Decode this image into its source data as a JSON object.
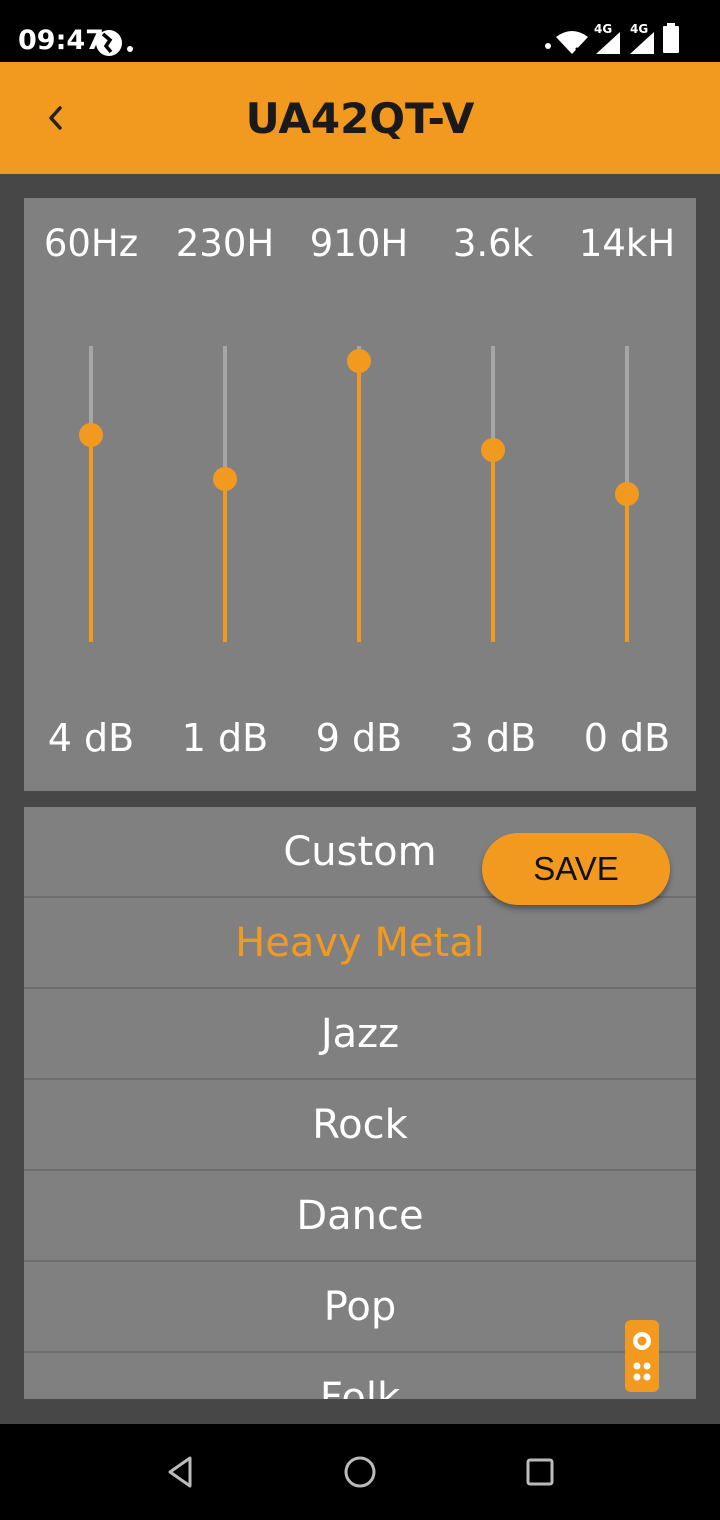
{
  "status_bar": {
    "time": "09:47",
    "network_label_1": "4G",
    "network_label_2": "4G"
  },
  "app_bar": {
    "title": "UA42QT-V"
  },
  "equalizer": {
    "min_db": -10,
    "max_db": 10,
    "bands": [
      {
        "frequency": "60Hz",
        "gain_label": "4 dB",
        "gain_db": 4
      },
      {
        "frequency": "230H",
        "gain_label": "1 dB",
        "gain_db": 1
      },
      {
        "frequency": "910H",
        "gain_label": "9 dB",
        "gain_db": 9
      },
      {
        "frequency": "3.6k",
        "gain_label": "3 dB",
        "gain_db": 3
      },
      {
        "frequency": "14kH",
        "gain_label": "0 dB",
        "gain_db": 0
      }
    ]
  },
  "presets": {
    "items": [
      "Custom",
      "Heavy Metal",
      "Jazz",
      "Rock",
      "Dance",
      "Pop",
      "Folk"
    ],
    "selected_index": 1
  },
  "save_button": {
    "label": "SAVE"
  },
  "colors": {
    "accent": "#F29A20",
    "panel": "#808080",
    "background": "#474747"
  },
  "icons": {
    "back": "chevron-left-icon",
    "remote": "remote-control-icon",
    "nav_back": "triangle-back-icon",
    "nav_home": "circle-home-icon",
    "nav_recents": "square-recents-icon"
  }
}
